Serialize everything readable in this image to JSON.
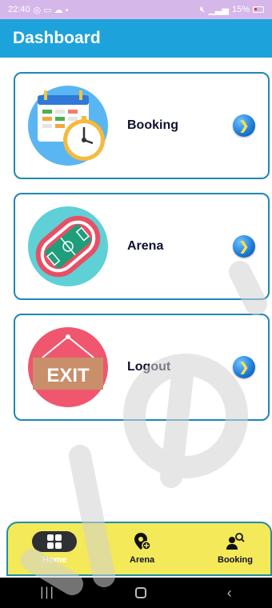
{
  "status_bar": {
    "time": "22:40",
    "battery": "15%"
  },
  "app_bar": {
    "title": "Dashboard"
  },
  "cards": [
    {
      "label": "Booking"
    },
    {
      "label": "Arena"
    },
    {
      "label": "Logout",
      "exit_sign": "EXIT"
    }
  ],
  "bottom_nav": {
    "items": [
      {
        "label": "Home",
        "active": true
      },
      {
        "label": "Arena"
      },
      {
        "label": "Booking"
      }
    ]
  },
  "colors": {
    "app_bar": "#1ea2dc",
    "card_border": "#1d87b8",
    "bottom_nav": "#f3e959"
  }
}
